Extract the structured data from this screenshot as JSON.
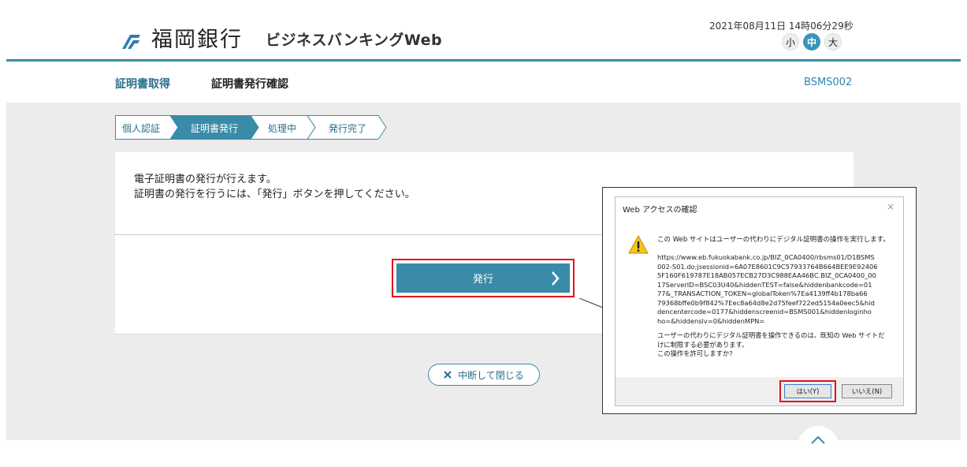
{
  "header": {
    "bank_name": "福岡銀行",
    "service_name": "ビジネスバンキングWeb",
    "datetime": "2021年08月11日 14時06分29秒",
    "font_sizes": [
      {
        "label": "小",
        "active": false
      },
      {
        "label": "中",
        "active": true
      },
      {
        "label": "大",
        "active": false
      }
    ]
  },
  "subheader": {
    "category": "証明書取得",
    "title": "証明書発行確認",
    "screen_id": "BSMS002"
  },
  "steps": [
    {
      "label": "個人認証",
      "state": "done"
    },
    {
      "label": "証明書発行",
      "state": "current"
    },
    {
      "label": "処理中",
      "state": "todo"
    },
    {
      "label": "発行完了",
      "state": "todo"
    }
  ],
  "main": {
    "message_line1": "電子証明書の発行が行えます。",
    "message_line2": "証明書の発行を行うには、「発行」ボタンを押してください。",
    "issue_button": "発行",
    "close_button": "中断して閉じる"
  },
  "dialog": {
    "title": "Web アクセスの確認",
    "warning_text": "この Web サイトはユーザーの代わりにデジタル証明書の操作を実行します。",
    "url_lines": [
      "https://www.eb.fukuokabank.co.jp/BIZ_0CA0400/rbsms01/D1BSMS",
      "002-S01.do;jsessionid=6A07E8601C9C57933764B664BEE9E92406",
      "5F160F619787E18AB057ECB27D3C988EAA46BC.BIZ_0CA0400_00",
      "17ServerID=BSC03U40&hiddenTEST=false&hiddenbankcode=01",
      "77&_TRANSACTION_TOKEN=globalToken%7Ea4139ff4b178ba66",
      "79368bffe0b9f842%7Eec8a64d8e2d75feef722ed5154a0eec5&hid",
      "dencentercode=0177&hiddenscreenid=BSMS001&hiddenloginho",
      "ho=&hiddenslv=0&hiddenMPN="
    ],
    "question_lines": [
      "ユーザーの代わりにデジタル証明書を操作できるのは、既知の Web サイトだ",
      "けに制限する必要があります。",
      "この操作を許可しますか?"
    ],
    "yes_button": "はい(Y)",
    "no_button": "いいえ(N)",
    "close_glyph": "×"
  },
  "colors": {
    "accent": "#3a8ba8",
    "highlight": "#e0141c"
  }
}
